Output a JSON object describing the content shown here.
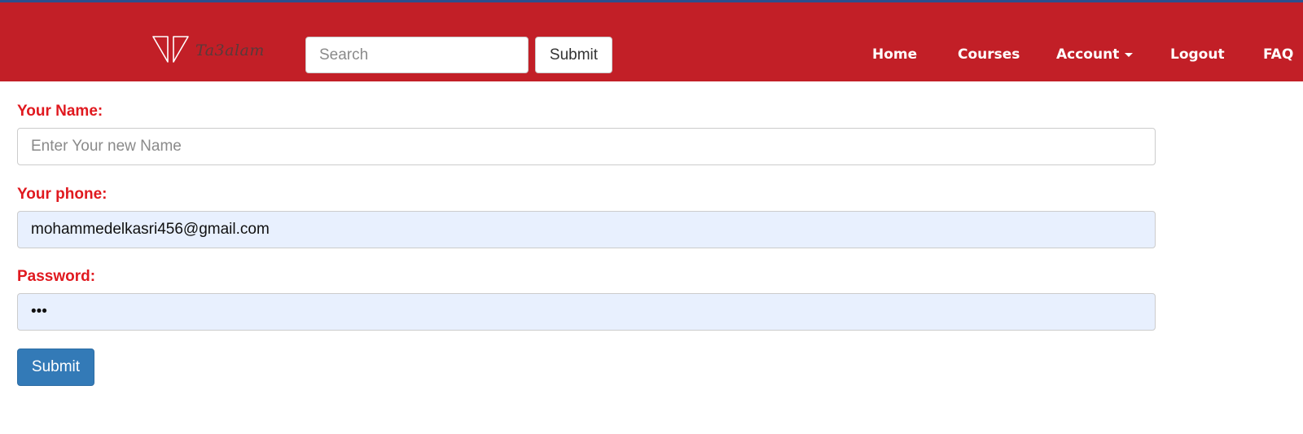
{
  "header": {
    "logo_text": "Ta3alam",
    "search": {
      "placeholder": "Search",
      "value": ""
    },
    "search_button_label": "Submit",
    "nav": {
      "home": "Home",
      "courses": "Courses",
      "account": "Account",
      "logout": "Logout",
      "faq": "FAQ"
    }
  },
  "form": {
    "name": {
      "label": "Your Name:",
      "placeholder": "Enter Your new Name",
      "value": ""
    },
    "phone": {
      "label": "Your phone:",
      "value": "mohammedelkasri456@gmail.com"
    },
    "password": {
      "label": "Password:",
      "value": "123"
    },
    "submit_label": "Submit"
  },
  "colors": {
    "navbar": "#c21f27",
    "label": "#e0191f",
    "primary_button": "#337ab7",
    "autofill_background": "#e8f0fe"
  },
  "icons": {
    "logo": "ta3alam-book-logo-icon",
    "account_dropdown": "caret-down-icon"
  }
}
